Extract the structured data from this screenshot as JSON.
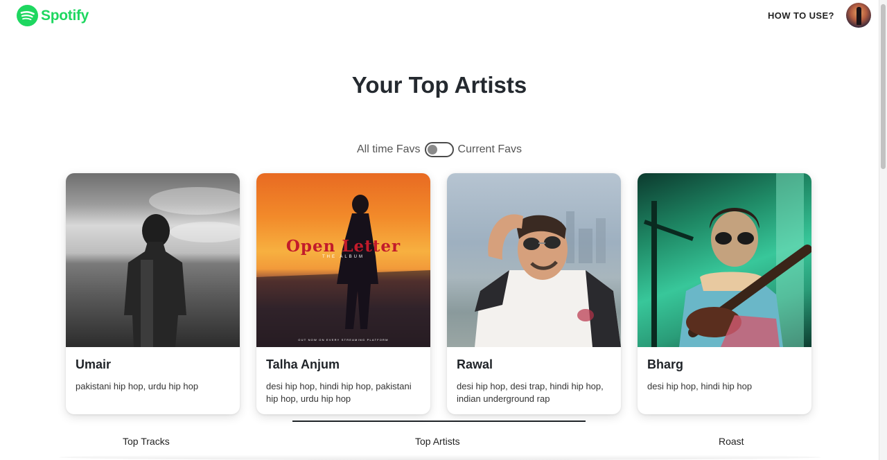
{
  "header": {
    "brand": "Spotify",
    "how_to_use": "HOW TO USE?",
    "avatar_icon": "user-avatar"
  },
  "main": {
    "title": "Your Top Artists",
    "toggle": {
      "left_label": "All time Favs",
      "right_label": "Current Favs",
      "state": "all-time"
    },
    "artists": [
      {
        "name": "Umair",
        "genres": "pakistani hip hop, urdu hip hop"
      },
      {
        "name": "Talha Anjum",
        "genres": "desi hip hop, hindi hip hop, pakistani hip hop, urdu hip hop",
        "cover_title": "Open Letter",
        "cover_subtitle": "THE ALBUM",
        "cover_footer": "OUT NOW ON EVERY STREAMING PLATFORM"
      },
      {
        "name": "Rawal",
        "genres": "desi hip hop, desi trap, hindi hip hop, indian underground rap"
      },
      {
        "name": "Bharg",
        "genres": "desi hip hop, hindi hip hop"
      }
    ]
  },
  "tabs": {
    "items": [
      {
        "label": "Top Tracks"
      },
      {
        "label": "Top Artists"
      },
      {
        "label": "Roast"
      }
    ],
    "active": "Top Artists"
  },
  "colors": {
    "brand": "#1ed760",
    "text": "#1f2328",
    "muted": "#555555"
  }
}
